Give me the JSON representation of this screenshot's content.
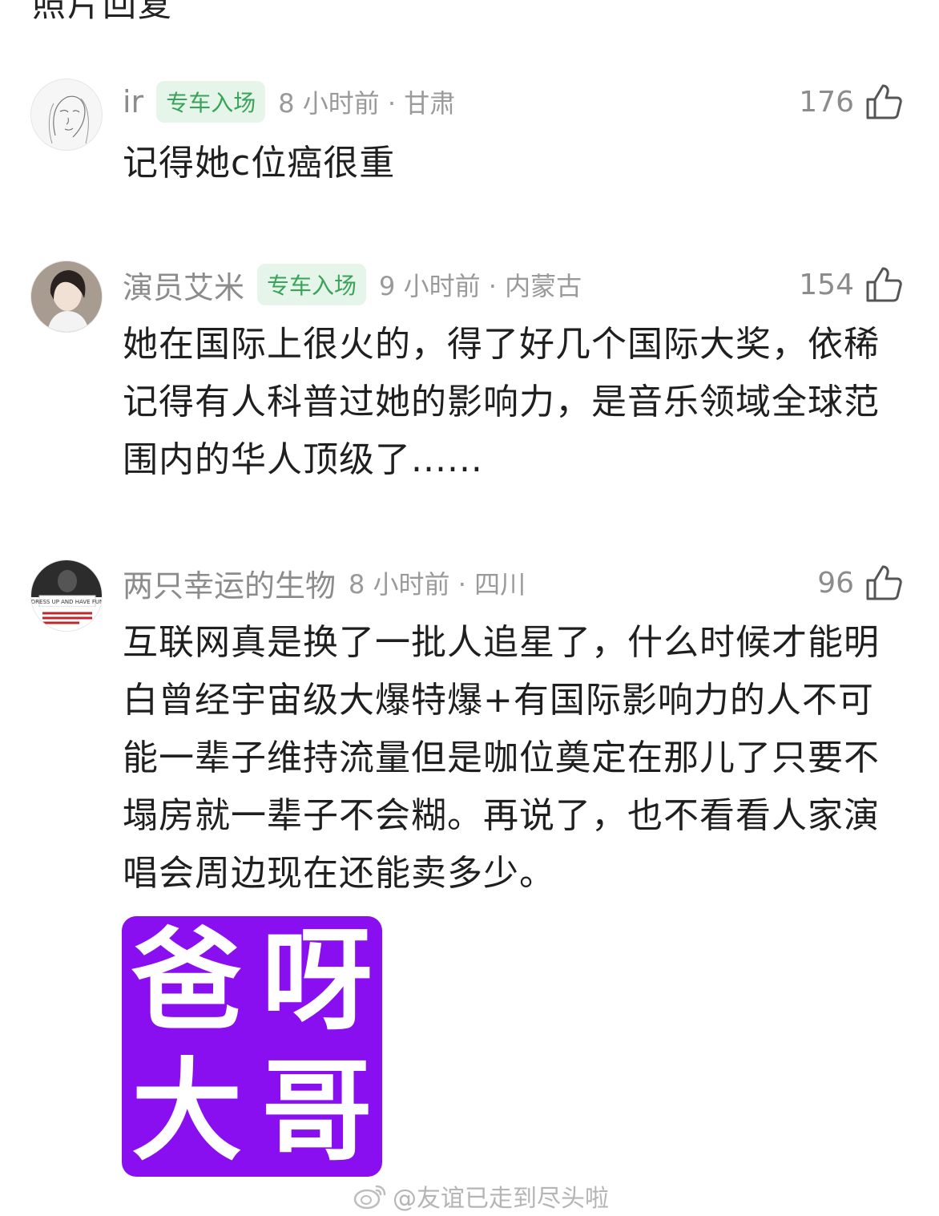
{
  "top_partial_text": "照片回复",
  "comments": [
    {
      "username": "ir",
      "badge": "专车入场",
      "meta": "8 小时前 · 甘肃",
      "likes": "176",
      "text": "记得她c位癌很重"
    },
    {
      "username": "演员艾米",
      "badge": "专车入场",
      "meta": "9 小时前 · 内蒙古",
      "likes": "154",
      "text": "她在国际上很火的，得了好几个国际大奖，依稀记得有人科普过她的影响力，是音乐领域全球范围内的华人顶级了......"
    },
    {
      "username": "两只幸运的生物",
      "meta": "8 小时前 · 四川",
      "likes": "96",
      "text": "互联网真是换了一批人追星了，什么时候才能明白曾经宇宙级大爆特爆+有国际影响力的人不可能一辈子维持流量但是咖位奠定在那儿了只要不塌房就一辈子不会糊。再说了，也不看看人家演唱会周边现在还能卖多少。",
      "sticker": {
        "chars": [
          "爸",
          "呀",
          "大",
          "哥"
        ],
        "background": "#8a0ff0"
      }
    }
  ],
  "watermark": "@友谊已走到尽头啦",
  "colors": {
    "badge_text": "#3aa35a",
    "badge_bg": "#e6f5e9",
    "meta": "#9a9a9a",
    "sticker": "#8a0ff0"
  },
  "icons": {
    "like": "thumbs-up-outline-icon",
    "watermark": "weibo-logo-icon"
  }
}
